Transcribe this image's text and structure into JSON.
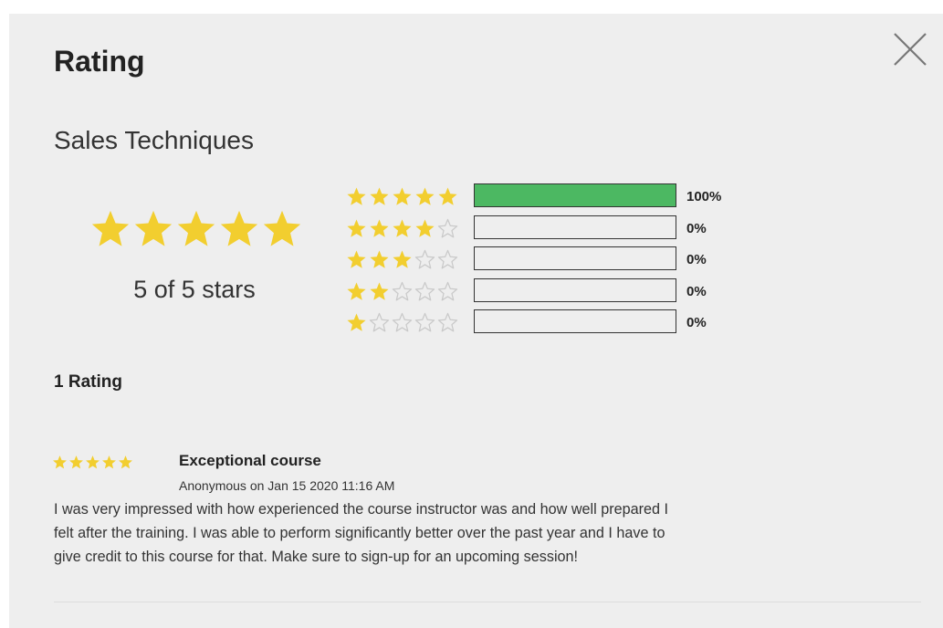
{
  "header": {
    "title": "Rating",
    "close_icon": "close-icon"
  },
  "course": {
    "name": "Sales Techniques"
  },
  "summary": {
    "average_rating": 5,
    "max_rating": 5,
    "average_label": "5 of 5 stars",
    "rating_count_label": "1 Rating"
  },
  "distribution": [
    {
      "stars": 5,
      "fraction": 1.0,
      "percent_label": "100%"
    },
    {
      "stars": 4,
      "fraction": 0.0,
      "percent_label": "0%"
    },
    {
      "stars": 3,
      "fraction": 0.0,
      "percent_label": "0%"
    },
    {
      "stars": 2,
      "fraction": 0.0,
      "percent_label": "0%"
    },
    {
      "stars": 1,
      "fraction": 0.0,
      "percent_label": "0%"
    }
  ],
  "reviews": [
    {
      "stars": 5,
      "title": "Exceptional course",
      "meta": "Anonymous on Jan 15 2020 11:16 AM",
      "body": "I was very impressed with how experienced the course instructor was and how well prepared I felt after the training. I was able to perform significantly better over the past year and I have to give credit to this course for that. Make sure to sign-up for an upcoming session!"
    }
  ],
  "colors": {
    "star_filled": "#f2ce2f",
    "star_empty_stroke": "#c9c9c9",
    "bar_fill": "#4cb862",
    "background": "#eeeeee"
  }
}
